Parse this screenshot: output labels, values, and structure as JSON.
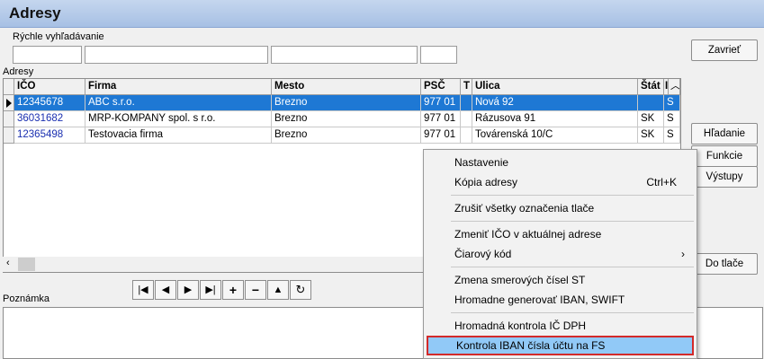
{
  "title": "Adresy",
  "search": {
    "label": "Rýchle vyhľadávanie"
  },
  "buttons": {
    "close": "Zavrieť",
    "search": "Hľadanie",
    "functions": "Funkcie",
    "outputs": "Výstupy",
    "print": "Do tlače"
  },
  "grid": {
    "label": "Adresy",
    "columns": [
      "IČO",
      "Firma",
      "Mesto",
      "PSČ",
      "T",
      "Ulica",
      "Štát",
      "I"
    ],
    "rows": [
      {
        "ico": "12345678",
        "firma": "ABC s.r.o.",
        "mesto": "Brezno",
        "psc": "977 01",
        "t": "",
        "ulica": "Nová 92",
        "stat": "",
        "i": "S",
        "selected": true
      },
      {
        "ico": "36031682",
        "firma": "MRP-KOMPANY spol. s r.o.",
        "mesto": "Brezno",
        "psc": "977 01",
        "t": "",
        "ulica": "Rázusova 91",
        "stat": "SK",
        "i": "S",
        "selected": false
      },
      {
        "ico": "12365498",
        "firma": "Testovacia firma",
        "mesto": "Brezno",
        "psc": "977 01",
        "t": "",
        "ulica": "Továrenská 10/C",
        "stat": "SK",
        "i": "S",
        "selected": false
      }
    ]
  },
  "note": {
    "label": "Poznámka"
  },
  "navigator": {
    "icons": [
      "first-record-icon",
      "prior-record-icon",
      "next-record-icon",
      "last-record-icon",
      "insert-icon",
      "delete-icon",
      "edit-icon",
      "refresh-icon"
    ],
    "glyphs": [
      "|◀",
      "◀",
      "▶",
      "▶|",
      "+",
      "−",
      "▲",
      "↻"
    ]
  },
  "context_menu": {
    "items": [
      {
        "label": "Nastavenie"
      },
      {
        "label": "Kópia adresy",
        "shortcut": "Ctrl+K"
      },
      {
        "label": "Zrušiť všetky označenia tlače"
      },
      {
        "label": "Zmeniť IČO v aktuálnej adrese"
      },
      {
        "label": "Čiarový kód",
        "submenu": "›"
      },
      {
        "label": "Zmena smerových čísel ST"
      },
      {
        "label": "Hromadne generovať IBAN, SWIFT"
      },
      {
        "label": "Hromadná kontrola IČ DPH"
      },
      {
        "label": "Kontrola IBAN čísla účtu na FS",
        "highlighted": true
      }
    ]
  },
  "colors": {
    "selection": "#1e78d4",
    "highlight": "#91c9f7",
    "highlight_border": "#d32a2a",
    "title_bar": "#b3c9e8"
  }
}
